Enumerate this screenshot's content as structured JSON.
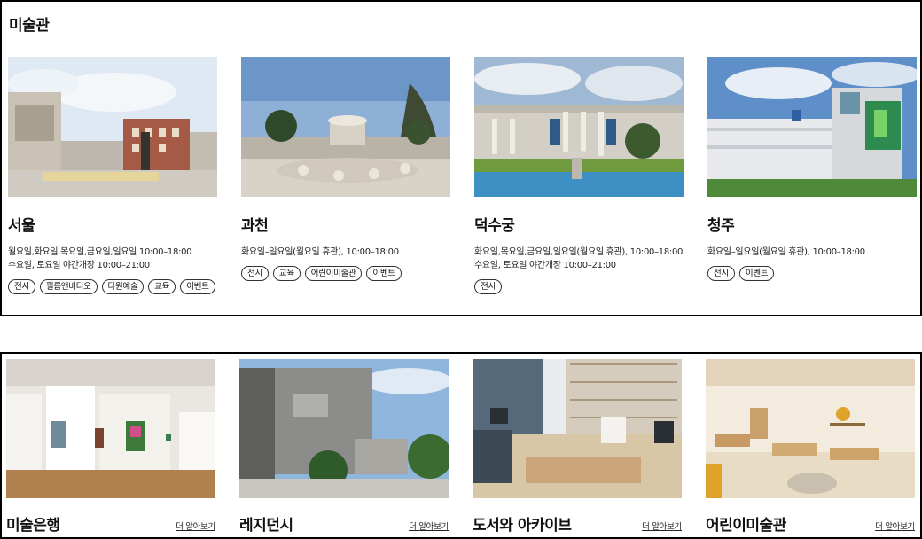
{
  "section_title": "미술관",
  "museums": [
    {
      "name": "서울",
      "hours": [
        "월요일,화요일,목요일,금요일,일요일 10:00–18:00",
        "수요일, 토요일 야간개장 10:00–21:00"
      ],
      "tags": [
        "전시",
        "필름앤비디오",
        "다원예술",
        "교육",
        "이벤트"
      ]
    },
    {
      "name": "과천",
      "hours": [
        "화요일–일요일(월요일 휴관), 10:00–18:00"
      ],
      "tags": [
        "전시",
        "교육",
        "어린이미술관",
        "이벤트"
      ]
    },
    {
      "name": "덕수궁",
      "hours": [
        "화요일,목요일,금요일,일요일(월요일 휴관), 10:00–18:00",
        "수요일, 토요일 야간개장 10:00–21:00"
      ],
      "tags": [
        "전시"
      ]
    },
    {
      "name": "청주",
      "hours": [
        "화요일–일요일(월요일 휴관), 10:00–18:00"
      ],
      "tags": [
        "전시",
        "이벤트"
      ]
    }
  ],
  "facilities": [
    {
      "name": "미술은행",
      "more": "더 알아보기"
    },
    {
      "name": "레지던시",
      "more": "더 알아보기"
    },
    {
      "name": "도서와 아카이브",
      "more": "더 알아보기"
    },
    {
      "name": "어린이미술관",
      "more": "더 알아보기"
    }
  ]
}
